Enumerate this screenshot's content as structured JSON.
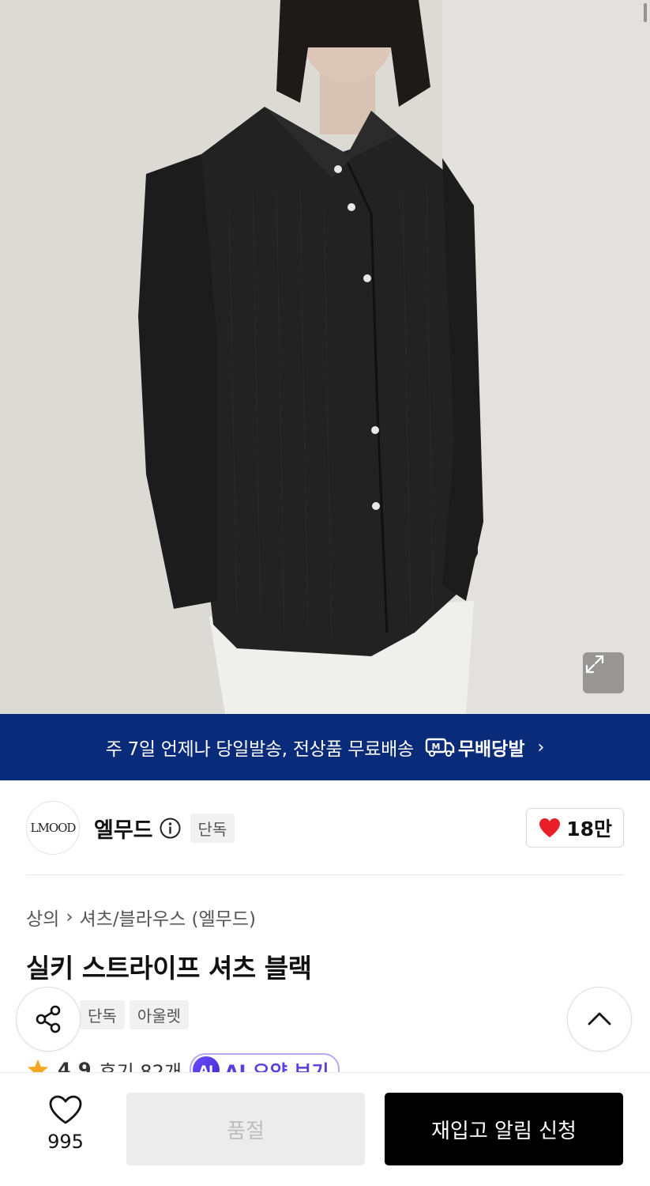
{
  "banner": {
    "text": "주 7일 언제나 당일발송, 전상품 무료배송",
    "logo_mark": "M",
    "logo_text": "무배당발",
    "chevron": "›"
  },
  "brand": {
    "logo_text": "LMOOD",
    "name": "엘무드",
    "tag": "단독",
    "likes": "18만"
  },
  "breadcrumb": {
    "category": "상의",
    "separator": "›",
    "subcategory": "셔츠/블라우스 (엘무드)"
  },
  "product": {
    "title": "실키 스트라이프 셔츠 블랙",
    "tags": [
      "단독",
      "아울렛"
    ]
  },
  "rating": {
    "score": "4.9",
    "reviews": "후기 82개",
    "ai_badge": "AI",
    "ai_summary": "AI 요약 보기"
  },
  "bottom_bar": {
    "wish_count": "995",
    "soldout_label": "품절",
    "restock_label": "재입고 알림 신청"
  },
  "colors": {
    "banner_bg": "#0a2a7a",
    "heart_red": "#e8202a",
    "star": "#f5a623",
    "ai_purple": "#5a3ee0"
  },
  "icons": [
    "expand-icon",
    "info-icon",
    "heart-icon",
    "share-icon",
    "chevron-up-icon",
    "star-icon",
    "heart-outline-icon",
    "truck-icon"
  ]
}
